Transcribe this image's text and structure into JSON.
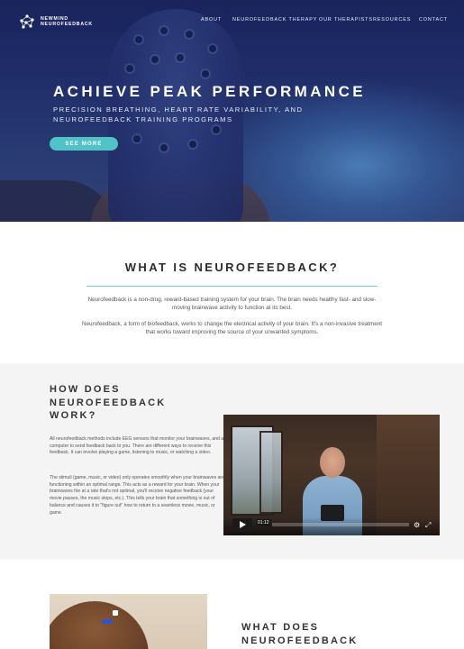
{
  "brand": {
    "line1": "NEWMIND",
    "line2": "NEUROFEEDBACK",
    "icon": "brain-network-icon"
  },
  "nav": {
    "items": [
      {
        "label": "ABOUT"
      },
      {
        "label": "NEUROFEEDBACK THERAPY"
      },
      {
        "label": "OUR THERAPISTS"
      },
      {
        "label": "RESOURCES"
      },
      {
        "label": "CONTACT"
      }
    ]
  },
  "hero": {
    "title": "ACHIEVE PEAK PERFORMANCE",
    "subtitle": "PRECISION BREATHING, HEART RATE VARIABILITY, AND NEUROFEEDBACK TRAINING PROGRAMS",
    "cta_label": "SEE MORE",
    "cta_color": "#4fc3c7"
  },
  "what_is": {
    "title_prefix": "WHAT IS ",
    "title_bold": "NEUROFEEDBACK",
    "title_suffix": "?",
    "paragraphs": [
      "Neurofeedback is a non-drug, reward-based training system for your brain. The brain needs healthy fast- and slow-moving brainwave activity to function at its best.",
      "Neurofeedback, a form of biofeedback, works to change the electrical activity of your brain. It's a non-invasive treatment that works toward improving the source of your unwanted symptoms."
    ]
  },
  "how_does": {
    "title": "HOW DOES NEUROFEEDBACK WORK?",
    "paragraphs": [
      "All neurofeedback methods include EEG sensors that monitor your brainwaves, and a computer to send feedback back to you. There are different ways to receive this feedback. It can involve playing a game, listening to music, or watching a video.",
      "The stimuli (game, music, or video) only operates smoothly when your brainwaves are functioning within an optimal range. This acts as a reward for your brain. When your brainwaves fire at a rate that's not optimal, you'll receive negative feedback (your movie pauses, the music stops, etc.). This tells your brain that something is out of balance and causes it to \"figure out\" how to return to a seamless movie, music, or game."
    ],
    "video": {
      "time": "01:12",
      "play_icon": "play-icon",
      "settings_icon": "gear-icon",
      "fullscreen_icon": "fullscreen-icon",
      "progress": 0
    }
  },
  "what_does": {
    "title": "WHAT DOES NEUROFEEDBACK"
  }
}
